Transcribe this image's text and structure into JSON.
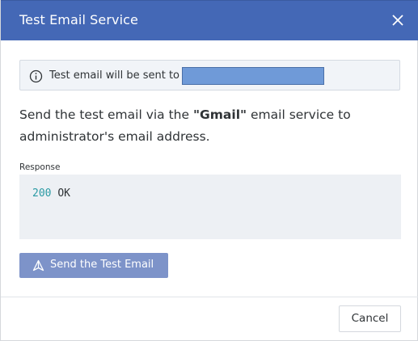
{
  "dialog": {
    "title": "Test Email Service",
    "close_icon": "close-icon"
  },
  "info": {
    "icon": "info-icon",
    "text": "Test email will be sent to"
  },
  "description": {
    "prefix": "Send the test email via the ",
    "service_name": "\"Gmail\"",
    "suffix": " email service to administrator's email address."
  },
  "response": {
    "label": "Response",
    "status_code": "200",
    "status_text": "OK"
  },
  "actions": {
    "send_label": "Send the Test Email",
    "send_icon": "send-icon",
    "cancel_label": "Cancel"
  },
  "colors": {
    "header_bg": "#4468b6",
    "send_button_bg": "#7d93c9",
    "status_code_color": "#2a9aa4"
  }
}
